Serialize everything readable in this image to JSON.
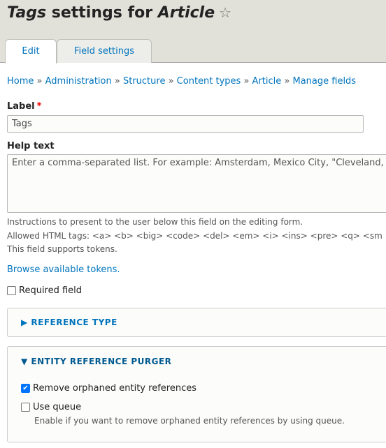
{
  "header": {
    "title_field": "Tags",
    "title_mid": " settings for ",
    "title_bundle": "Article",
    "star_icon": "star-outline-icon"
  },
  "tabs": [
    {
      "label": "Edit",
      "active": true
    },
    {
      "label": "Field settings",
      "active": false
    }
  ],
  "breadcrumb": [
    "Home",
    "Administration",
    "Structure",
    "Content types",
    "Article",
    "Manage fields"
  ],
  "breadcrumb_sep": " » ",
  "label": {
    "title": "Label",
    "value": "Tags"
  },
  "help": {
    "title": "Help text",
    "value": "Enter a comma-separated list. For example: Amsterdam, Mexico City, \"Cleveland,",
    "desc1": "Instructions to present to the user below this field on the editing form.",
    "desc2": "Allowed HTML tags: <a> <b> <big> <code> <del> <em> <i> <ins> <pre> <q> <sm",
    "desc3": "This field supports tokens."
  },
  "browse_tokens": "Browse available tokens.",
  "required": {
    "label": "Required field",
    "checked": false
  },
  "reference_type": {
    "title": "REFERENCE TYPE",
    "open": false
  },
  "purger": {
    "title": "ENTITY REFERENCE PURGER",
    "open": true,
    "remove": {
      "label": "Remove orphaned entity references",
      "checked": true
    },
    "queue": {
      "label": "Use queue",
      "checked": false,
      "desc": "Enable if you want to remove orphaned entity references by using queue."
    }
  },
  "colors": {
    "link": "#0074bd",
    "header_bg": "#e1e0d9",
    "checkbox": "#0075ff"
  }
}
